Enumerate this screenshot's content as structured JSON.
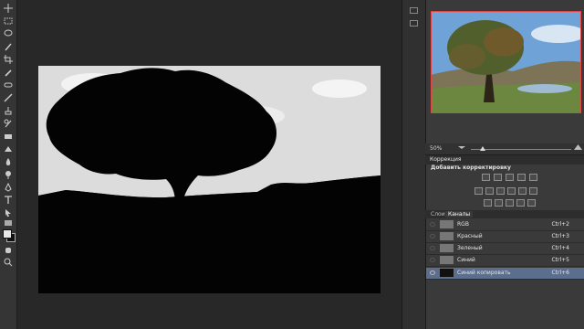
{
  "colors": {
    "selected_row": "#5b6e8e",
    "nav_frame": "#e04545",
    "canvas_bg": "#030303"
  },
  "toolbar": {
    "tools": [
      "move-tool-icon",
      "marquee-tool-icon",
      "lasso-tool-icon",
      "quick-select-icon",
      "crop-tool-icon",
      "eyedropper-tool-icon",
      "healing-brush-icon",
      "brush-tool-icon",
      "clone-stamp-icon",
      "history-brush-icon",
      "eraser-tool-icon",
      "gradient-tool-icon",
      "blur-tool-icon",
      "dodge-tool-icon",
      "pen-tool-icon",
      "type-tool-icon",
      "path-select-icon",
      "shape-tool-icon",
      "hand-tool-icon",
      "zoom-tool-icon"
    ]
  },
  "navigator": {
    "zoom_label": "50%"
  },
  "adjustments": {
    "tab_label": "Коррекция",
    "subtitle": "Добавить корректировку"
  },
  "layers": {
    "tabs": [
      "Слои",
      "Каналы"
    ],
    "active_tab": 1,
    "channels": [
      {
        "name": "RGB",
        "shortcut": "Ctrl+2",
        "visible": false,
        "selected": false
      },
      {
        "name": "Красный",
        "shortcut": "Ctrl+3",
        "visible": false,
        "selected": false
      },
      {
        "name": "Зеленый",
        "shortcut": "Ctrl+4",
        "visible": false,
        "selected": false
      },
      {
        "name": "Синий",
        "shortcut": "Ctrl+5",
        "visible": false,
        "selected": false
      },
      {
        "name": "Синий копировать",
        "shortcut": "Ctrl+6",
        "visible": true,
        "selected": true
      }
    ]
  }
}
